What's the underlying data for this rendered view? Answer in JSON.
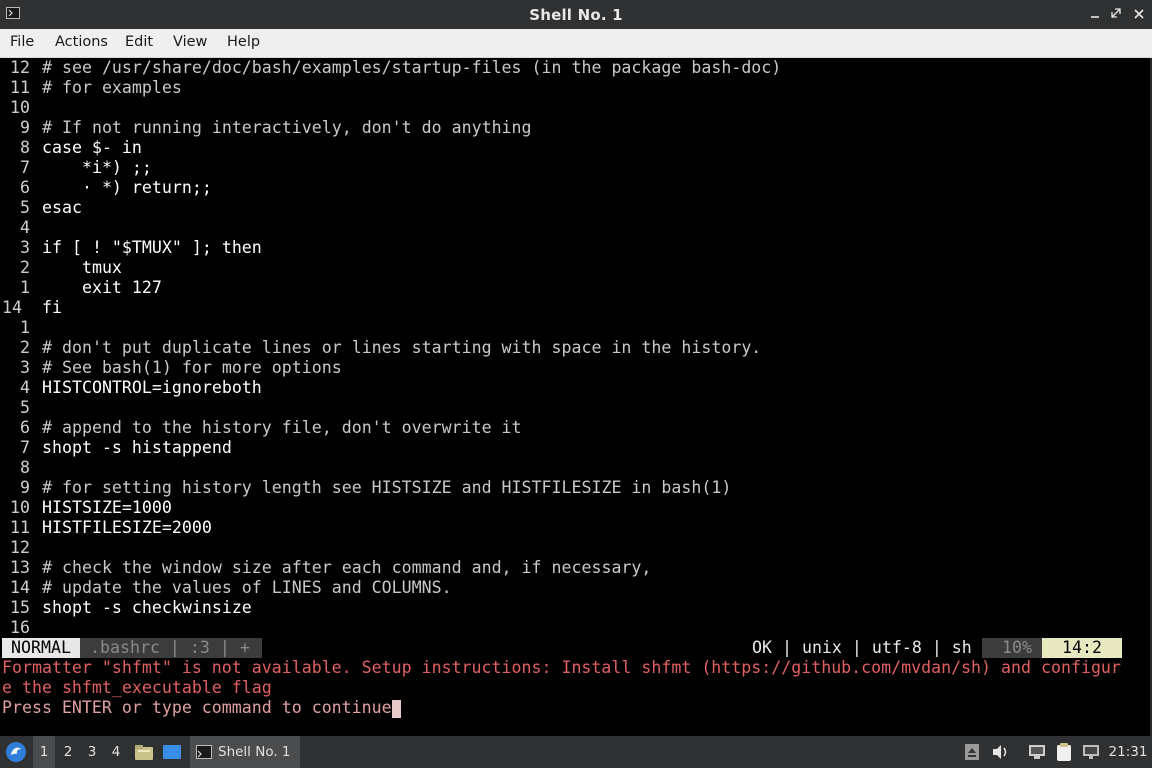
{
  "window": {
    "title": "Shell No. 1"
  },
  "menu": [
    "File",
    "Actions",
    "Edit",
    "View",
    "Help"
  ],
  "editor": {
    "lines": [
      {
        "n": "12",
        "t": "# see /usr/share/doc/bash/examples/startup-files (in the package bash-doc)"
      },
      {
        "n": "11",
        "t": "# for examples"
      },
      {
        "n": "10",
        "t": ""
      },
      {
        "n": "9",
        "t": "# If not running interactively, don't do anything"
      },
      {
        "n": "8",
        "t": "case $- in"
      },
      {
        "n": "7",
        "t": "    *i*) ;;"
      },
      {
        "n": "6",
        "t": "    · *) return;;"
      },
      {
        "n": "5",
        "t": "esac"
      },
      {
        "n": "4",
        "t": ""
      },
      {
        "n": "3",
        "t": "if [ ! \"$TMUX\" ]; then"
      },
      {
        "n": "2",
        "t": "    tmux"
      },
      {
        "n": "1",
        "t": "    exit 127"
      },
      {
        "n": "14",
        "t": "fi"
      },
      {
        "n": "1",
        "t": ""
      },
      {
        "n": "2",
        "t": "# don't put duplicate lines or lines starting with space in the history."
      },
      {
        "n": "3",
        "t": "# See bash(1) for more options"
      },
      {
        "n": "4",
        "t": "HISTCONTROL=ignoreboth"
      },
      {
        "n": "5",
        "t": ""
      },
      {
        "n": "6",
        "t": "# append to the history file, don't overwrite it"
      },
      {
        "n": "7",
        "t": "shopt -s histappend"
      },
      {
        "n": "8",
        "t": ""
      },
      {
        "n": "9",
        "t": "# for setting history length see HISTSIZE and HISTFILESIZE in bash(1)"
      },
      {
        "n": "10",
        "t": "HISTSIZE=1000"
      },
      {
        "n": "11",
        "t": "HISTFILESIZE=2000"
      },
      {
        "n": "12",
        "t": ""
      },
      {
        "n": "13",
        "t": "# check the window size after each command and, if necessary,"
      },
      {
        "n": "14",
        "t": "# update the values of LINES and COLUMNS."
      },
      {
        "n": "15",
        "t": "shopt -s checkwinsize"
      },
      {
        "n": "16",
        "t": ""
      }
    ],
    "status": {
      "mode": "NORMAL",
      "file_info": ".bashrc | :3 | +",
      "right_info": "OK | unix | utf-8 | sh",
      "percent": "10%",
      "position": "14:2"
    },
    "message_line1": "Formatter \"shfmt\" is not available. Setup instructions: Install shfmt (https://github.com/mvdan/sh) and configur",
    "message_line2": "e the shfmt_executable flag",
    "prompt": "Press ENTER or type command to continue"
  },
  "taskbar": {
    "workspaces": [
      "1",
      "2",
      "3",
      "4"
    ],
    "active_workspace": "1",
    "task_label": "Shell No. 1",
    "clock": "21:31",
    "icons": [
      "start-menu-icon",
      "file-manager-icon",
      "desktop-icon",
      "terminal-icon",
      "eject-icon",
      "volume-icon",
      "network-icon",
      "clipboard-icon",
      "display-icon"
    ]
  }
}
